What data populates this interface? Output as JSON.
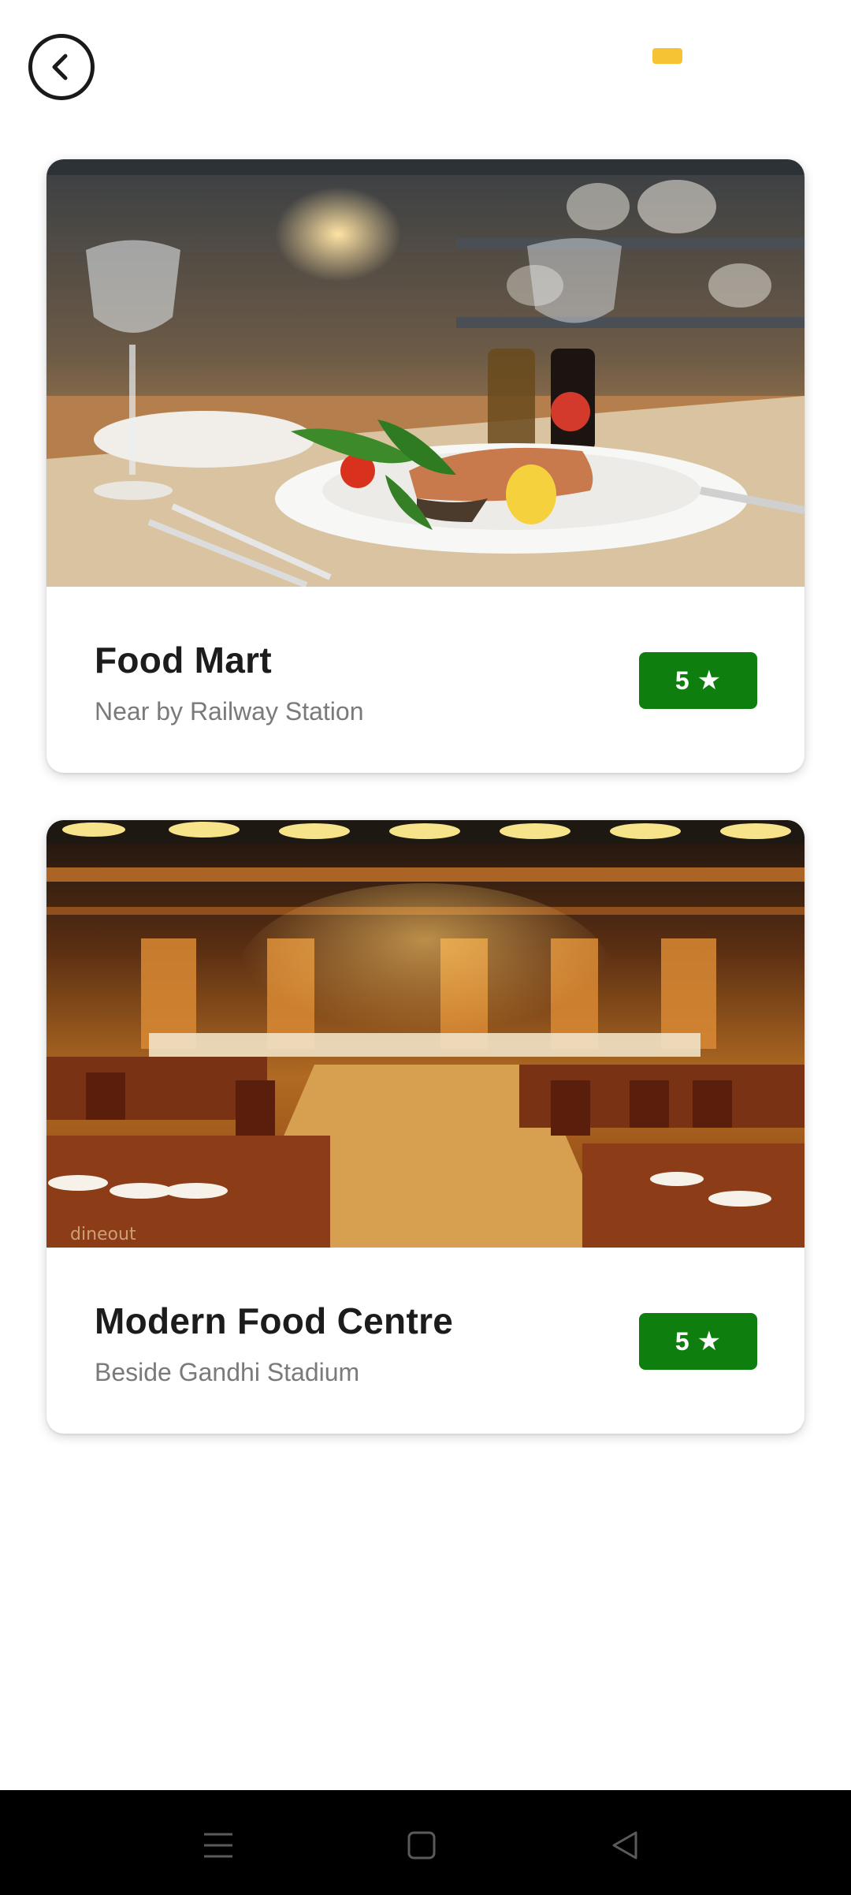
{
  "header": {
    "back_icon": "chevron-left-icon",
    "indicator_color": "#f5c333"
  },
  "restaurants": [
    {
      "name": "Food Mart",
      "location": "Near by Railway Station",
      "rating": "5",
      "rating_icon": "★",
      "image": "plated-fish-dish-photo"
    },
    {
      "name": "Modern Food Centre",
      "location": "Beside Gandhi Stadium",
      "rating": "5",
      "rating_icon": "★",
      "image": "restaurant-interior-photo",
      "image_watermark": "dineout"
    }
  ],
  "colors": {
    "rating_badge": "#0e7f0e",
    "title": "#1c1c1c",
    "subtitle": "#7a7a7a",
    "nav_bar": "#000000"
  },
  "nav": {
    "menu_icon": "menu-icon",
    "home_icon": "square-home-icon",
    "back_icon": "triangle-back-icon"
  }
}
